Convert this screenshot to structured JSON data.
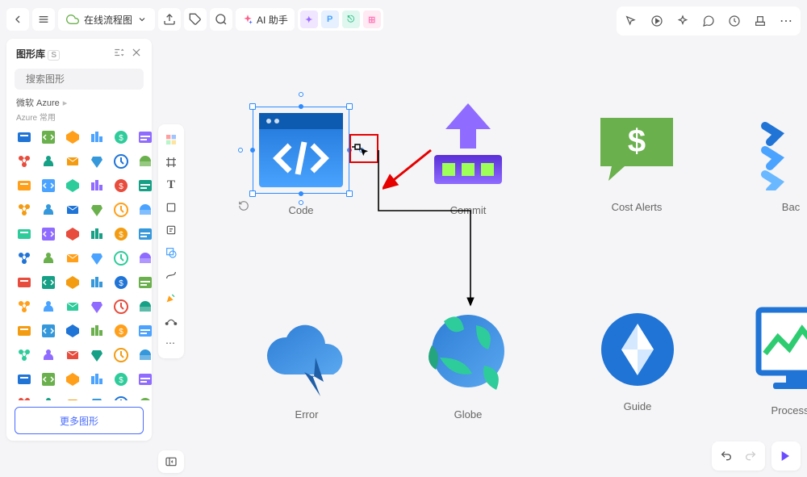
{
  "header": {
    "file_name": "在线流程图",
    "ai_label": "AI 助手",
    "pills": [
      {
        "t": "",
        "bg": "#f1e6ff",
        "c": "#9b6dff",
        "dot": true
      },
      {
        "t": "P",
        "bg": "#e6f0ff",
        "c": "#4aa3ff"
      },
      {
        "t": "",
        "bg": "#e0f7ef",
        "c": "#35c28c",
        "brk": true
      },
      {
        "t": "",
        "bg": "#ffe9f3",
        "c": "#ff7ab8",
        "grid": true
      }
    ]
  },
  "shape_panel": {
    "title": "图形库",
    "title_badge": "S",
    "search_placeholder": "搜索图形",
    "lib_title": "微软 Azure",
    "lib_sub": "Azure 常用",
    "more": "更多图形"
  },
  "float_toolbar": {
    "label": "Code"
  },
  "canvas_nodes": {
    "code": "Code",
    "commit": "Commit",
    "cost": "Cost Alerts",
    "back": "Bac",
    "error": "Error",
    "globe": "Globe",
    "guide": "Guide",
    "process": "Process"
  },
  "colors": {
    "blue_grad_a": "#1f74d6",
    "blue_grad_b": "#4aa3ff",
    "purple_a": "#7b3ff2",
    "purple_b": "#b58bff",
    "green": "#6ab04c",
    "teal": "#2ecc9a",
    "orange": "#ff9f1a",
    "violet": "#6a4cff"
  }
}
